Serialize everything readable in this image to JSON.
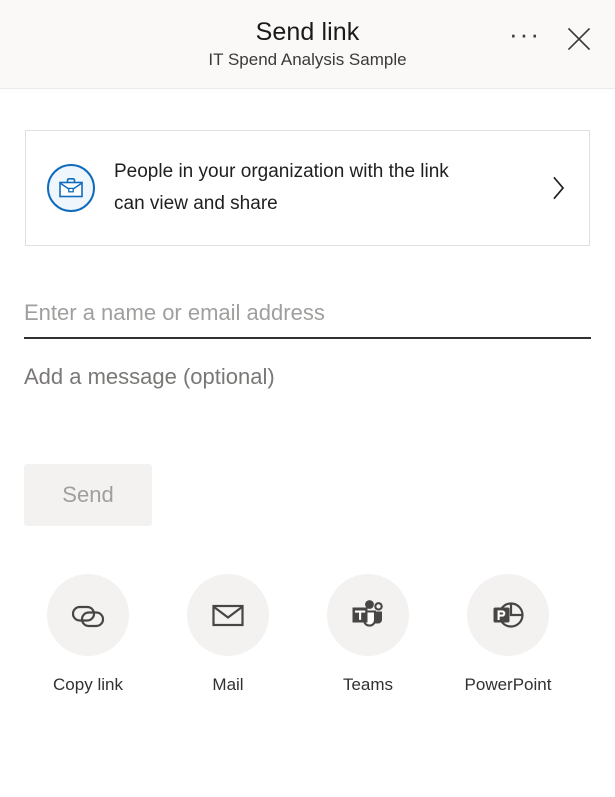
{
  "header": {
    "title": "Send link",
    "subtitle": "IT Spend Analysis Sample",
    "more_options_label": "···",
    "more_options_name": "more-options-icon",
    "close_name": "close-icon"
  },
  "permission": {
    "icon_name": "briefcase-icon",
    "line1": "People in your organization with the link",
    "line2": "can view and share",
    "chevron_name": "chevron-right-icon",
    "accent_color": "#0f6cbd",
    "icon_fill": "#eff6fc"
  },
  "recipients": {
    "placeholder": "Enter a name or email address",
    "value": ""
  },
  "message": {
    "placeholder": "Add a message (optional)",
    "value": ""
  },
  "send": {
    "label": "Send",
    "disabled_bg": "#f3f2f1",
    "disabled_text": "#a19f9d"
  },
  "share_targets": [
    {
      "label": "Copy link",
      "icon": "link-icon"
    },
    {
      "label": "Mail",
      "icon": "envelope-icon"
    },
    {
      "label": "Teams",
      "icon": "teams-icon"
    },
    {
      "label": "PowerPoint",
      "icon": "powerpoint-icon"
    }
  ]
}
